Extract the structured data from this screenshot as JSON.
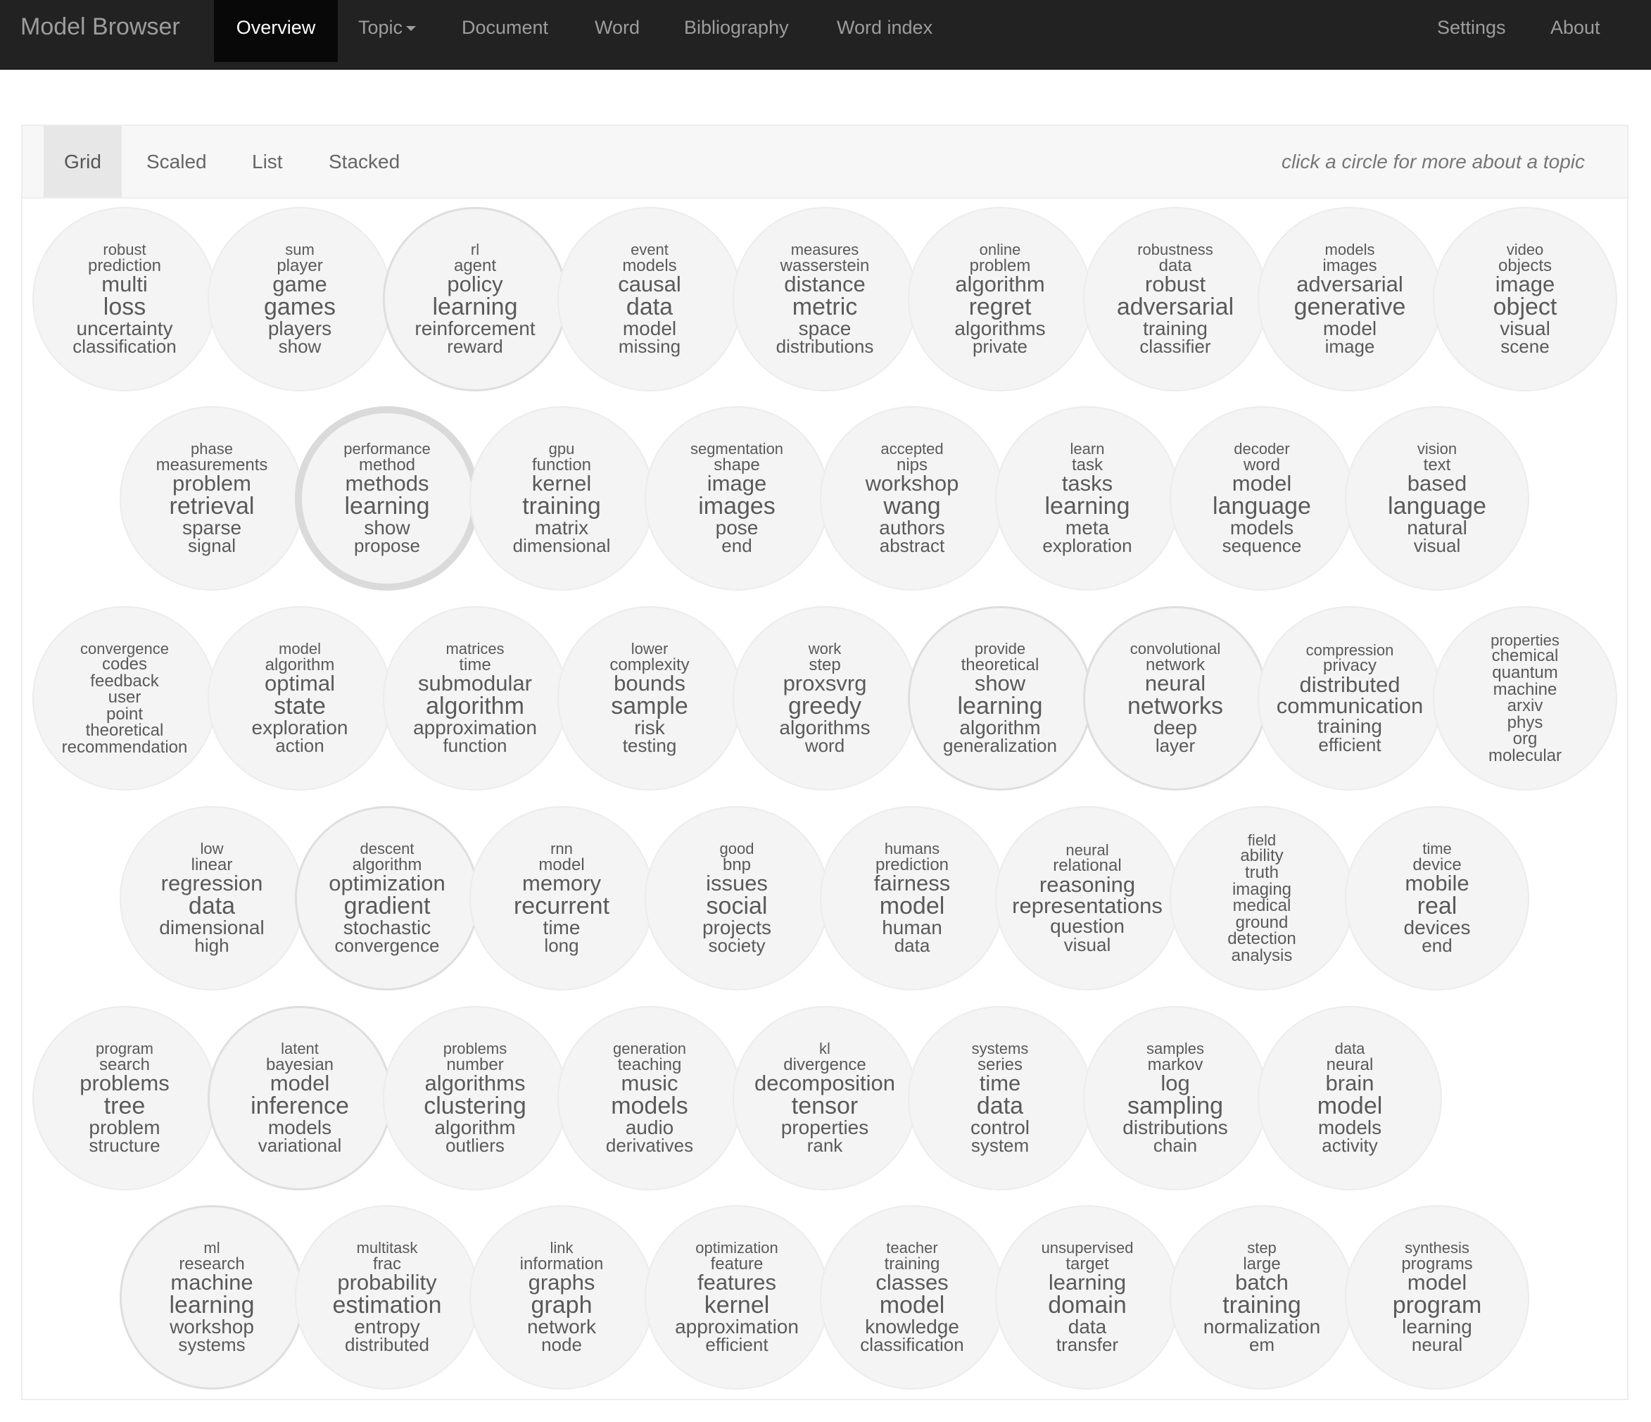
{
  "navbar": {
    "brand": "Model Browser",
    "items": [
      "Overview",
      "Topic",
      "Document",
      "Word",
      "Bibliography",
      "Word index"
    ],
    "right_items": [
      "Settings",
      "About"
    ]
  },
  "view_tabs": [
    "Grid",
    "Scaled",
    "List",
    "Stacked"
  ],
  "hint": "click a circle for more about a topic",
  "topics": [
    [
      "robust",
      "prediction",
      "multi",
      "loss",
      "uncertainty",
      "classification"
    ],
    [
      "sum",
      "player",
      "game",
      "games",
      "players",
      "show"
    ],
    [
      "rl",
      "agent",
      "policy",
      "learning",
      "reinforcement",
      "reward"
    ],
    [
      "event",
      "models",
      "causal",
      "data",
      "model",
      "missing"
    ],
    [
      "measures",
      "wasserstein",
      "distance",
      "metric",
      "space",
      "distributions"
    ],
    [
      "online",
      "problem",
      "algorithm",
      "regret",
      "algorithms",
      "private"
    ],
    [
      "robustness",
      "data",
      "robust",
      "adversarial",
      "training",
      "classifier"
    ],
    [
      "models",
      "images",
      "adversarial",
      "generative",
      "model",
      "image"
    ],
    [
      "video",
      "objects",
      "image",
      "object",
      "visual",
      "scene"
    ],
    [
      "phase",
      "measurements",
      "problem",
      "retrieval",
      "sparse",
      "signal"
    ],
    [
      "performance",
      "method",
      "methods",
      "learning",
      "show",
      "propose"
    ],
    [
      "gpu",
      "function",
      "kernel",
      "training",
      "matrix",
      "dimensional"
    ],
    [
      "segmentation",
      "shape",
      "image",
      "images",
      "pose",
      "end"
    ],
    [
      "accepted",
      "nips",
      "workshop",
      "wang",
      "authors",
      "abstract"
    ],
    [
      "learn",
      "task",
      "tasks",
      "learning",
      "meta",
      "exploration"
    ],
    [
      "decoder",
      "word",
      "model",
      "language",
      "models",
      "sequence"
    ],
    [
      "vision",
      "text",
      "based",
      "language",
      "natural",
      "visual"
    ],
    [
      "convergence",
      "codes",
      "feedback",
      "user",
      "point",
      "theoretical",
      "recommendation"
    ],
    [
      "model",
      "algorithm",
      "optimal",
      "state",
      "exploration",
      "action"
    ],
    [
      "matrices",
      "time",
      "submodular",
      "algorithm",
      "approximation",
      "function"
    ],
    [
      "lower",
      "complexity",
      "bounds",
      "sample",
      "risk",
      "testing"
    ],
    [
      "work",
      "step",
      "proxsvrg",
      "greedy",
      "algorithms",
      "word"
    ],
    [
      "provide",
      "theoretical",
      "show",
      "learning",
      "algorithm",
      "generalization"
    ],
    [
      "convolutional",
      "network",
      "neural",
      "networks",
      "deep",
      "layer"
    ],
    [
      "compression",
      "privacy",
      "distributed",
      "communication",
      "training",
      "efficient"
    ],
    [
      "properties",
      "chemical",
      "quantum",
      "machine",
      "arxiv",
      "phys",
      "org",
      "molecular"
    ],
    [
      "low",
      "linear",
      "regression",
      "data",
      "dimensional",
      "high"
    ],
    [
      "descent",
      "algorithm",
      "optimization",
      "gradient",
      "stochastic",
      "convergence"
    ],
    [
      "rnn",
      "model",
      "memory",
      "recurrent",
      "time",
      "long"
    ],
    [
      "good",
      "bnp",
      "issues",
      "social",
      "projects",
      "society"
    ],
    [
      "humans",
      "prediction",
      "fairness",
      "model",
      "human",
      "data"
    ],
    [
      "neural",
      "relational",
      "reasoning",
      "representations",
      "question",
      "visual"
    ],
    [
      "field",
      "ability",
      "truth",
      "imaging",
      "medical",
      "ground",
      "detection",
      "analysis"
    ],
    [
      "time",
      "device",
      "mobile",
      "real",
      "devices",
      "end"
    ],
    [
      "program",
      "search",
      "problems",
      "tree",
      "problem",
      "structure"
    ],
    [
      "latent",
      "bayesian",
      "model",
      "inference",
      "models",
      "variational"
    ],
    [
      "problems",
      "number",
      "algorithms",
      "clustering",
      "algorithm",
      "outliers"
    ],
    [
      "generation",
      "teaching",
      "music",
      "models",
      "audio",
      "derivatives"
    ],
    [
      "kl",
      "divergence",
      "decomposition",
      "tensor",
      "properties",
      "rank"
    ],
    [
      "systems",
      "series",
      "time",
      "data",
      "control",
      "system"
    ],
    [
      "samples",
      "markov",
      "log",
      "sampling",
      "distributions",
      "chain"
    ],
    [
      "data",
      "neural",
      "brain",
      "model",
      "models",
      "activity"
    ],
    [
      "ml",
      "research",
      "machine",
      "learning",
      "workshop",
      "systems"
    ],
    [
      "multitask",
      "frac",
      "probability",
      "estimation",
      "entropy",
      "distributed"
    ],
    [
      "link",
      "information",
      "graphs",
      "graph",
      "network",
      "node"
    ],
    [
      "optimization",
      "feature",
      "features",
      "kernel",
      "approximation",
      "efficient"
    ],
    [
      "teacher",
      "training",
      "classes",
      "model",
      "knowledge",
      "classification"
    ],
    [
      "unsupervised",
      "target",
      "learning",
      "domain",
      "data",
      "transfer"
    ],
    [
      "step",
      "large",
      "batch",
      "training",
      "normalization",
      "em"
    ],
    [
      "synthesis",
      "programs",
      "model",
      "program",
      "learning",
      "neural"
    ]
  ]
}
